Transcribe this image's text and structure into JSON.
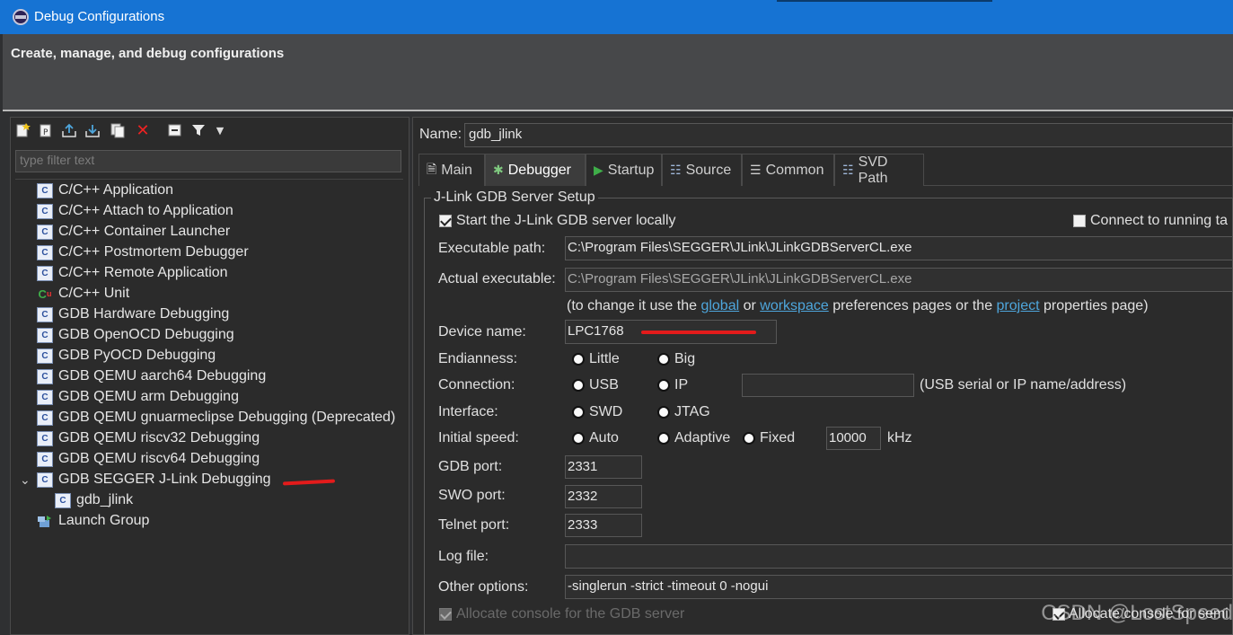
{
  "window": {
    "title": "Debug Configurations"
  },
  "banner": {
    "heading": "Create, manage, and debug configurations"
  },
  "filter": {
    "placeholder": "type filter text"
  },
  "tree": {
    "items": [
      {
        "label": "C/C++ Application",
        "icon": "c-config-icon"
      },
      {
        "label": "C/C++ Attach to Application",
        "icon": "c-config-icon"
      },
      {
        "label": "C/C++ Container Launcher",
        "icon": "c-config-icon"
      },
      {
        "label": "C/C++ Postmortem Debugger",
        "icon": "c-config-icon"
      },
      {
        "label": "C/C++ Remote Application",
        "icon": "c-config-icon"
      },
      {
        "label": "C/C++ Unit",
        "icon": "c-unit-icon"
      },
      {
        "label": "GDB Hardware Debugging",
        "icon": "c-config-icon"
      },
      {
        "label": "GDB OpenOCD Debugging",
        "icon": "c-config-icon"
      },
      {
        "label": "GDB PyOCD Debugging",
        "icon": "c-config-icon"
      },
      {
        "label": "GDB QEMU aarch64 Debugging",
        "icon": "c-config-icon"
      },
      {
        "label": "GDB QEMU arm Debugging",
        "icon": "c-config-icon"
      },
      {
        "label": "GDB QEMU gnuarmeclipse Debugging (Deprecated)",
        "icon": "c-config-icon"
      },
      {
        "label": "GDB QEMU riscv32 Debugging",
        "icon": "c-config-icon"
      },
      {
        "label": "GDB QEMU riscv64 Debugging",
        "icon": "c-config-icon"
      },
      {
        "label": "GDB SEGGER J-Link Debugging",
        "icon": "c-config-icon",
        "expanded": true
      },
      {
        "label": "gdb_jlink",
        "icon": "c-config-icon",
        "child": true
      },
      {
        "label": "Launch Group",
        "icon": "launch-group-icon"
      }
    ]
  },
  "config": {
    "name_label": "Name:",
    "name_value": "gdb_jlink"
  },
  "tabs": [
    {
      "label": "Main",
      "icon": "main-tab-icon"
    },
    {
      "label": "Debugger",
      "icon": "debugger-tab-icon",
      "active": true
    },
    {
      "label": "Startup",
      "icon": "startup-tab-icon"
    },
    {
      "label": "Source",
      "icon": "source-tab-icon"
    },
    {
      "label": "Common",
      "icon": "common-tab-icon"
    },
    {
      "label": "SVD Path",
      "icon": "svd-tab-icon"
    }
  ],
  "server": {
    "group_title": "J-Link GDB Server Setup",
    "start_locally": "Start the J-Link GDB server locally",
    "connect_running": "Connect to running ta",
    "exec_label": "Executable path:",
    "exec_value": "C:\\Program Files\\SEGGER\\JLink\\JLinkGDBServerCL.exe",
    "actual_label": "Actual executable:",
    "actual_value": "C:\\Program Files\\SEGGER\\JLink\\JLinkGDBServerCL.exe",
    "hint_prefix": "(to change it use the ",
    "hint_global": "global",
    "hint_or": " or ",
    "hint_workspace": "workspace",
    "hint_mid": " preferences pages or the ",
    "hint_project": "project",
    "hint_suffix": " properties page)",
    "device_label": "Device name:",
    "device_value": "LPC1768",
    "endian_label": "Endianness:",
    "endian_little": "Little",
    "endian_big": "Big",
    "conn_label": "Connection:",
    "conn_usb": "USB",
    "conn_ip": "IP",
    "conn_hint": "(USB serial or IP name/address)",
    "iface_label": "Interface:",
    "iface_swd": "SWD",
    "iface_jtag": "JTAG",
    "speed_label": "Initial speed:",
    "speed_auto": "Auto",
    "speed_adaptive": "Adaptive",
    "speed_fixed": "Fixed",
    "speed_value": "10000",
    "speed_unit": "kHz",
    "gdb_port_label": "GDB port:",
    "gdb_port_value": "2331",
    "swo_port_label": "SWO port:",
    "swo_port_value": "2332",
    "telnet_port_label": "Telnet port:",
    "telnet_port_value": "2333",
    "log_label": "Log file:",
    "log_value": "",
    "other_label": "Other options:",
    "other_value": "-singlerun -strict -timeout 0 -nogui",
    "alloc_console": "Allocate console for the GDB server",
    "alloc_semihosting": "Allocate console for semi"
  },
  "watermark": "CSDN @LostSpeed",
  "colors": {
    "titlebar": "#1673d3",
    "link": "#4ea6dc",
    "annotation": "#e31b1b"
  }
}
